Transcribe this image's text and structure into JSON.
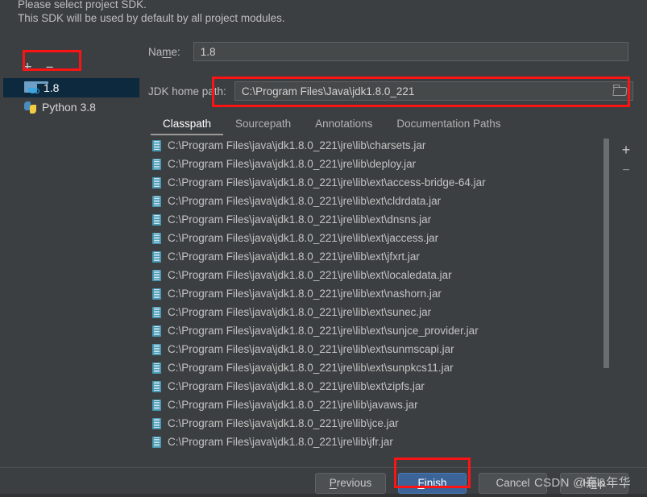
{
  "header": {
    "line1": "Please select project SDK.",
    "line2": "This SDK will be used by default by all project modules."
  },
  "sidebar": {
    "add_label": "+",
    "remove_label": "−",
    "items": [
      {
        "label": "1.8",
        "icon": "jdk-folder-icon",
        "selected": true
      },
      {
        "label": "Python 3.8",
        "icon": "python-icon",
        "selected": false
      }
    ]
  },
  "form": {
    "name_label_a": "Na",
    "name_label_mnemonic": "m",
    "name_label_b": "e:",
    "name_value": "1.8",
    "jdk_label": "JDK home path:",
    "jdk_value": "C:\\Program Files\\Java\\jdk1.8.0_221",
    "browse_icon": "folder-browse-icon"
  },
  "tabs": [
    {
      "label": "Classpath",
      "active": true
    },
    {
      "label": "Sourcepath",
      "active": false
    },
    {
      "label": "Annotations",
      "active": false
    },
    {
      "label": "Documentation Paths",
      "active": false
    }
  ],
  "classpath": {
    "add_label": "+",
    "remove_label": "−",
    "entries": [
      "C:\\Program Files\\java\\jdk1.8.0_221\\jre\\lib\\charsets.jar",
      "C:\\Program Files\\java\\jdk1.8.0_221\\jre\\lib\\deploy.jar",
      "C:\\Program Files\\java\\jdk1.8.0_221\\jre\\lib\\ext\\access-bridge-64.jar",
      "C:\\Program Files\\java\\jdk1.8.0_221\\jre\\lib\\ext\\cldrdata.jar",
      "C:\\Program Files\\java\\jdk1.8.0_221\\jre\\lib\\ext\\dnsns.jar",
      "C:\\Program Files\\java\\jdk1.8.0_221\\jre\\lib\\ext\\jaccess.jar",
      "C:\\Program Files\\java\\jdk1.8.0_221\\jre\\lib\\ext\\jfxrt.jar",
      "C:\\Program Files\\java\\jdk1.8.0_221\\jre\\lib\\ext\\localedata.jar",
      "C:\\Program Files\\java\\jdk1.8.0_221\\jre\\lib\\ext\\nashorn.jar",
      "C:\\Program Files\\java\\jdk1.8.0_221\\jre\\lib\\ext\\sunec.jar",
      "C:\\Program Files\\java\\jdk1.8.0_221\\jre\\lib\\ext\\sunjce_provider.jar",
      "C:\\Program Files\\java\\jdk1.8.0_221\\jre\\lib\\ext\\sunmscapi.jar",
      "C:\\Program Files\\java\\jdk1.8.0_221\\jre\\lib\\ext\\sunpkcs11.jar",
      "C:\\Program Files\\java\\jdk1.8.0_221\\jre\\lib\\ext\\zipfs.jar",
      "C:\\Program Files\\java\\jdk1.8.0_221\\jre\\lib\\javaws.jar",
      "C:\\Program Files\\java\\jdk1.8.0_221\\jre\\lib\\jce.jar",
      "C:\\Program Files\\java\\jdk1.8.0_221\\jre\\lib\\jfr.jar"
    ]
  },
  "buttons": {
    "previous": {
      "mnemonic": "P",
      "rest": "revious"
    },
    "finish": {
      "mnemonic": "F",
      "rest": "inish"
    },
    "cancel": {
      "label": "Cancel"
    },
    "help": {
      "pre": "H",
      "mnemonic": "e",
      "rest": "lp"
    }
  },
  "watermark": "CSDN @嘉&年华",
  "colors": {
    "background": "#3c3f41",
    "selection": "#0d293e",
    "primary_button": "#3c6498",
    "annotation": "#fc1414",
    "jar_icon": "#4a9ab5"
  }
}
